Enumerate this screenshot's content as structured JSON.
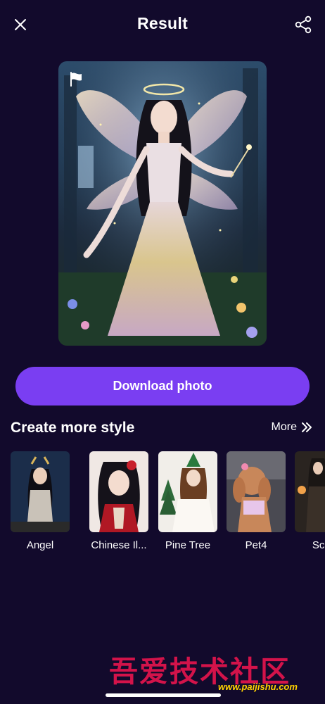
{
  "header": {
    "title": "Result",
    "close_icon": "close-icon",
    "share_icon": "share-icon"
  },
  "result": {
    "badge_icon": "flag-icon"
  },
  "download_label": "Download photo",
  "section": {
    "title": "Create more style",
    "more_label": "More",
    "more_icon": "double-chevron-right-icon"
  },
  "styles": [
    {
      "label": "Angel"
    },
    {
      "label": "Chinese Il..."
    },
    {
      "label": "Pine Tree"
    },
    {
      "label": "Pet4"
    },
    {
      "label": "Scoo"
    }
  ],
  "watermark": {
    "text": "吾爱技术社区",
    "url": "www.paijishu.com"
  },
  "colors": {
    "background": "#120a2c",
    "accent": "#7a3ef2",
    "watermark_red": "#d3134a",
    "watermark_yellow": "#ffd200"
  }
}
